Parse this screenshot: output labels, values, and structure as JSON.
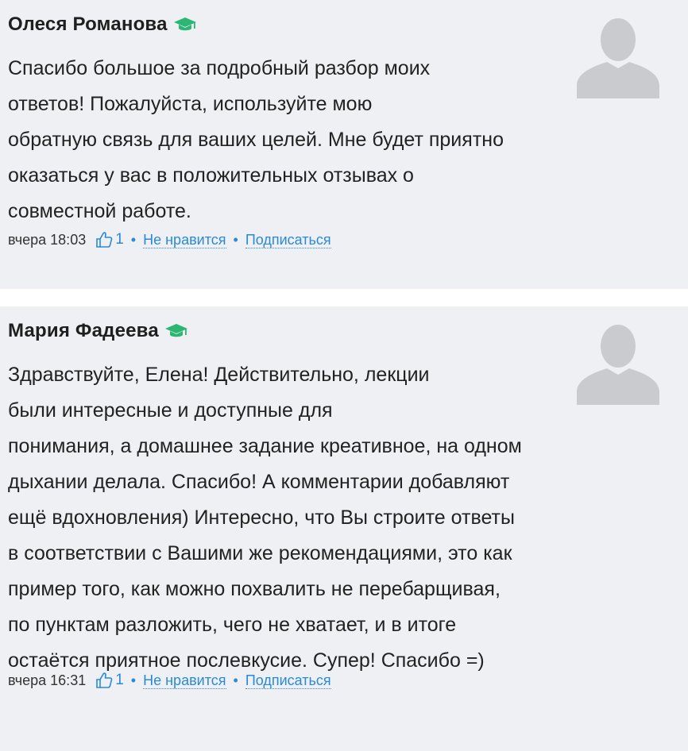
{
  "comments": [
    {
      "author": "Олеся Романова",
      "badge_icon": "graduation-cap-icon",
      "text": "Спасибо большое за подробный разбор моих\nответов! Пожалуйста, используйте мою\nобратную связь для ваших целей. Мне будет приятно\nоказаться у вас в положительных отзывах о\nсовместной работе.",
      "timestamp": "вчера 18:03",
      "likes": "1",
      "dislike_label": "Не нравится",
      "subscribe_label": "Подписаться",
      "separator": "•"
    },
    {
      "author": "Мария Фадеева",
      "badge_icon": "graduation-cap-icon",
      "text": "Здравствуйте, Елена! Действительно, лекции\nбыли интересные и доступные для\nпонимания, а домашнее задание креативное, на одном\nдыхании делала. Спасибо! А комментарии добавляют\nещё вдохновления) Интересно, что Вы строите ответы\nв соответствии с Вашими же рекомендациями, это как\nпример того, как можно похвалить не перебарщивая,\nпо пунктам разложить, чего не хватает, и в итоге\nостаётся приятное послевкусие. Супер! Спасибо =)",
      "timestamp": "вчера 16:31",
      "likes": "1",
      "dislike_label": "Не нравится",
      "subscribe_label": "Подписаться",
      "separator": "•"
    }
  ],
  "colors": {
    "card_background": "#eef0f4",
    "link": "#2a8ad8",
    "badge": "#2bb673",
    "avatar": "#c9cbcf"
  }
}
